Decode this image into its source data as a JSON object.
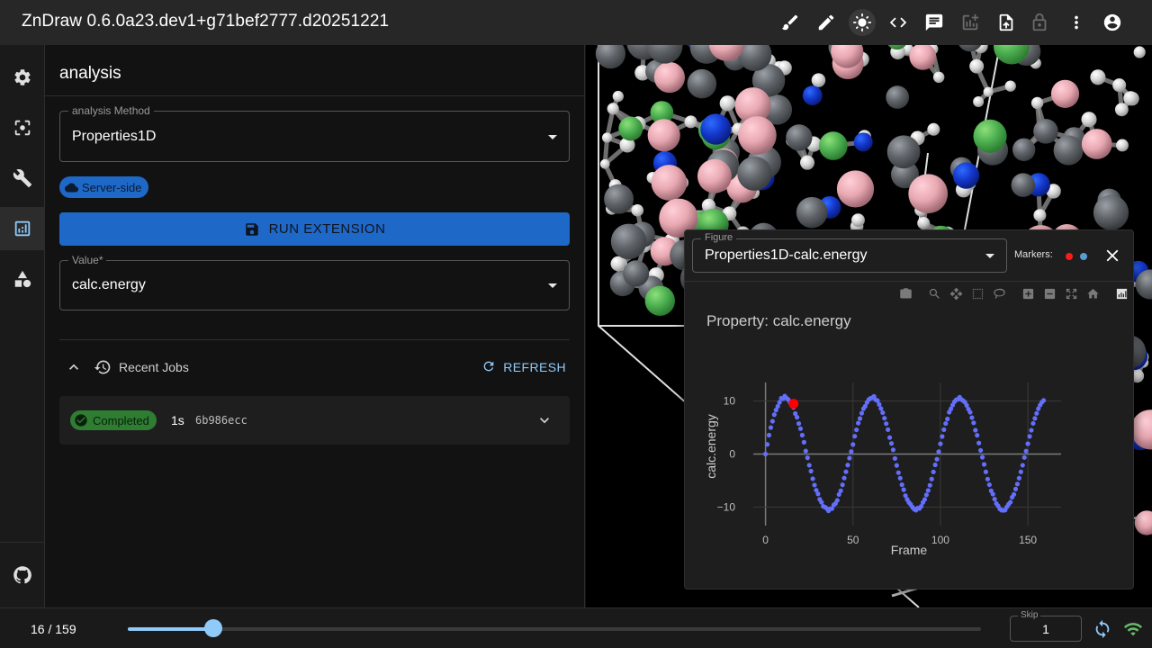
{
  "app": {
    "title": "ZnDraw 0.6.0a23.dev1+g71bef2777.d20251221"
  },
  "toolbar": {
    "icons": [
      "brush-icon",
      "pencil-icon",
      "brightness-icon",
      "code-icon",
      "comment-icon",
      "add-chart-icon",
      "upload-file-icon",
      "lock-icon",
      "more-vert-icon",
      "account-icon"
    ]
  },
  "rail": {
    "items": [
      "settings-icon",
      "selection-icon",
      "build-icon",
      "analysis-icon",
      "shapes-icon",
      "github-icon"
    ],
    "active": "analysis"
  },
  "panel": {
    "title": "analysis",
    "method": {
      "label": "analysis Method",
      "value": "Properties1D"
    },
    "chip": "Server-side",
    "run_label": "RUN EXTENSION",
    "value_field": {
      "label": "Value",
      "required_mark": "*",
      "value": "calc.energy"
    },
    "jobs": {
      "title": "Recent Jobs",
      "refresh_label": "REFRESH",
      "items": [
        {
          "status": "Completed",
          "duration": "1s",
          "id": "6b986ecc"
        }
      ]
    }
  },
  "figure": {
    "select_label": "Figure",
    "select_value": "Properties1D-calc.energy",
    "markers_label": "Markers:",
    "marker_colors": [
      "#ff1a1a",
      "#5b9bd5"
    ],
    "point_color": "#636efa",
    "highlight_color": "#ff0000"
  },
  "chart_data": {
    "type": "scatter",
    "title": "Property: calc.energy",
    "xlabel": "Frame",
    "ylabel": "calc.energy",
    "xlim": [
      -7,
      169
    ],
    "ylim": [
      -13.5,
      13.5
    ],
    "xticks": [
      0,
      50,
      100,
      150
    ],
    "yticks": [
      -10,
      0,
      10
    ],
    "x": [
      0,
      1,
      2,
      3,
      4,
      5,
      6,
      7,
      8,
      9,
      10,
      11,
      12,
      13,
      14,
      15,
      16,
      17,
      18,
      19,
      20,
      21,
      22,
      23,
      24,
      25,
      26,
      27,
      28,
      29,
      30,
      31,
      32,
      33,
      34,
      35,
      36,
      37,
      38,
      39,
      40,
      41,
      42,
      43,
      44,
      45,
      46,
      47,
      48,
      49,
      50,
      51,
      52,
      53,
      54,
      55,
      56,
      57,
      58,
      59,
      60,
      61,
      62,
      63,
      64,
      65,
      66,
      67,
      68,
      69,
      70,
      71,
      72,
      73,
      74,
      75,
      76,
      77,
      78,
      79,
      80,
      81,
      82,
      83,
      84,
      85,
      86,
      87,
      88,
      89,
      90,
      91,
      92,
      93,
      94,
      95,
      96,
      97,
      98,
      99,
      100,
      101,
      102,
      103,
      104,
      105,
      106,
      107,
      108,
      109,
      110,
      111,
      112,
      113,
      114,
      115,
      116,
      117,
      118,
      119,
      120,
      121,
      122,
      123,
      124,
      125,
      126,
      127,
      128,
      129,
      130,
      131,
      132,
      133,
      134,
      135,
      136,
      137,
      138,
      139,
      140,
      141,
      142,
      143,
      144,
      145,
      146,
      147,
      148,
      149,
      150,
      151,
      152,
      153,
      154,
      155,
      156,
      157,
      158,
      159
    ],
    "y": [
      0.0,
      1.82,
      3.57,
      5.0,
      6.19,
      7.43,
      8.3,
      9.01,
      9.76,
      10.53,
      10.45,
      10.93,
      10.56,
      10.28,
      9.72,
      9.44,
      8.81,
      7.64,
      6.94,
      5.75,
      4.79,
      3.57,
      2.23,
      0.58,
      -0.7,
      -2.11,
      -3.23,
      -4.66,
      -5.85,
      -6.83,
      -7.51,
      -8.54,
      -9.1,
      -9.87,
      -10.01,
      -10.25,
      -10.71,
      -10.33,
      -10.3,
      -9.6,
      -9.34,
      -8.74,
      -7.63,
      -6.93,
      -5.81,
      -4.53,
      -3.34,
      -2.08,
      -0.76,
      0.48,
      1.8,
      3.36,
      4.57,
      5.84,
      6.71,
      7.71,
      8.55,
      9.03,
      9.73,
      10.27,
      10.52,
      10.61,
      10.87,
      10.24,
      10.08,
      9.36,
      8.59,
      7.8,
      6.76,
      5.74,
      4.61,
      3.11,
      2.0,
      0.8,
      -0.84,
      -2.14,
      -3.51,
      -4.55,
      -5.79,
      -6.73,
      -7.84,
      -8.55,
      -9.13,
      -9.51,
      -10.02,
      -10.4,
      -10.6,
      -10.19,
      -10.27,
      -9.86,
      -9.14,
      -8.57,
      -7.71,
      -6.87,
      -5.89,
      -4.71,
      -3.37,
      -2.04,
      -0.98,
      0.45,
      1.93,
      3.31,
      4.6,
      5.76,
      6.62,
      7.89,
      8.53,
      9.24,
      9.86,
      10.23,
      10.35,
      10.73,
      10.29,
      10.07,
      9.79,
      9.19,
      8.48,
      7.88,
      6.87,
      5.89,
      4.5,
      3.54,
      2.08,
      0.69,
      -0.61,
      -1.95,
      -3.36,
      -4.72,
      -5.79,
      -6.93,
      -7.57,
      -8.51,
      -9.33,
      -9.79,
      -10.37,
      -10.59,
      -10.62,
      -10.57,
      -9.96,
      -9.47,
      -9.08,
      -8.15,
      -7.61,
      -6.6,
      -5.66,
      -4.55,
      -3.36,
      -2.11,
      -0.65,
      0.56,
      1.95,
      3.33,
      4.49,
      5.78,
      6.73,
      7.67,
      8.55,
      9.24,
      9.77,
      10.12,
      10.44,
      10.71,
      10.73,
      10.1
    ],
    "highlight": {
      "x": 16,
      "y": 9.48
    }
  },
  "bottom": {
    "frame_counter": "16 / 159",
    "current_frame": 16,
    "total_frames": 159,
    "skip_label": "Skip",
    "skip_value": "1"
  }
}
